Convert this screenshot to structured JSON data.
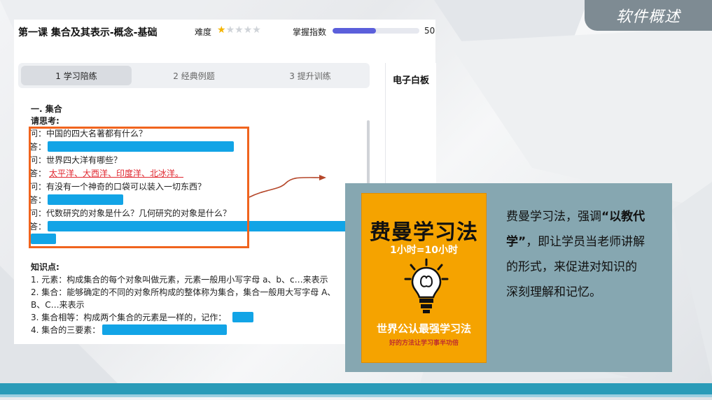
{
  "slide": {
    "section_title": "软件概述"
  },
  "header": {
    "lesson_title": "第一课 集合及其表示-概念-基础",
    "difficulty_label": "难度",
    "difficulty_stars": 1,
    "difficulty_max": 5,
    "mastery_label": "掌握指数",
    "mastery_value": "50.",
    "mastery_fraction": 0.5
  },
  "tabs": [
    {
      "label": "1 学习陪练"
    },
    {
      "label": "2 经典例题"
    },
    {
      "label": "3 提升训练"
    }
  ],
  "whiteboard": {
    "title": "电子白板"
  },
  "content": {
    "section": "一. 集合",
    "prompt": "请思考:",
    "qa": [
      {
        "q": "问：中国的四大名著都有什么？",
        "a_label": "答："
      },
      {
        "q": "问：世界四大洋有哪些？",
        "a_label": "答：",
        "a_text": "太平洋、大西洋、印度洋、北冰洋。"
      },
      {
        "q": "问：有没有一个神奇的口袋可以装入一切东西？",
        "a_label": "答："
      },
      {
        "q": "问：代数研究的对象是什么？几何研究的对象是什么？",
        "a_label": "答："
      }
    ],
    "knowledge_title": "知识点:",
    "knowledge": [
      "1. 元素：构成集合的每个对象叫做元素，元素一般用小写字母 a、b、c…来表示",
      "2. 集合：能够确定的不同的对象所构成的整体称为集合，集合一般用大写字母 A、",
      "B、C…来表示",
      "3. 集合相等：构成两个集合的元素是一样的，记作：",
      "4. 集合的三要素："
    ]
  },
  "callout": {
    "book_title": "费曼学习法",
    "book_subtitle": "1小时=10小时",
    "book_tagline": "世界公认最强学习法",
    "book_small": "好的方法让学习事半功倍",
    "text_1": "费曼学习法，强调",
    "text_bold": "“以教代学”",
    "text_2": "，即让学员当老师讲解的形式，来促进对知识的深刻理解和记忆。"
  },
  "colors": {
    "accent": "#5b5fdb",
    "blank": "#12a4e6",
    "highlight": "#f0641e",
    "callout_bg": "#86a7b1",
    "book_bg": "#f5a300",
    "footer": "#2a9bb8"
  }
}
